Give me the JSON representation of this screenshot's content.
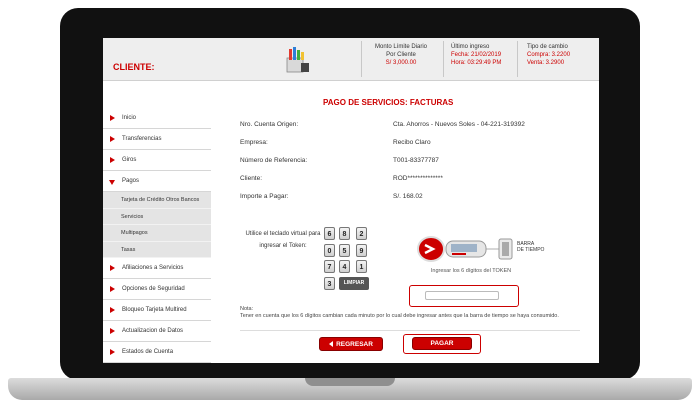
{
  "header": {
    "cliente_label": "CLIENTE:",
    "monto": {
      "line1": "Monto Límite Diario",
      "line2": "Por Cliente",
      "amount": "S/ 3,000.00"
    },
    "ingreso": {
      "title": "Último ingreso",
      "fecha": "Fecha: 21/02/2019",
      "hora": "Hora: 03:29:49 PM"
    },
    "cambio": {
      "title": "Tipo de cambio",
      "compra": "Compra: 3.2200",
      "venta": "Venta: 3.2900"
    }
  },
  "sidebar": {
    "items": [
      {
        "label": "Inicio"
      },
      {
        "label": "Transferencias"
      },
      {
        "label": "Giros"
      },
      {
        "label": "Pagos"
      },
      {
        "label": "Afiliaciones a Servicios"
      },
      {
        "label": "Opciones de Seguridad"
      },
      {
        "label": "Bloqueo Tarjeta Multired"
      },
      {
        "label": "Actualizacion de Datos"
      },
      {
        "label": "Estados de Cuenta"
      }
    ],
    "pagos_sub": [
      {
        "label": "Tarjeta de Crédito Otros Bancos"
      },
      {
        "label": "Servicios"
      },
      {
        "label": "Multipagos"
      },
      {
        "label": "Tasas"
      }
    ]
  },
  "main": {
    "title": "PAGO DE SERVICIOS: FACTURAS",
    "fields": [
      {
        "label": "Nro. Cuenta Origen:",
        "value": "Cta. Ahorros - Nuevos Soles - 04-221-319392"
      },
      {
        "label": "Empresa:",
        "value": "Recibo Claro"
      },
      {
        "label": "Número de Referencia:",
        "value": "T001-83377787"
      },
      {
        "label": "Cliente:",
        "value": "ROD**************"
      },
      {
        "label": "Importe a Pagar:",
        "value": "S/. 168.02"
      }
    ],
    "keypad_instruction": "Utilice el teclado virtual para ingresar el Token:",
    "keypad_keys": [
      "6",
      "8",
      "2",
      "0",
      "5",
      "9",
      "7",
      "4",
      "1",
      "3"
    ],
    "limpiar_label": "LIMPIAR",
    "barra_label_1": "BARRA",
    "barra_label_2": "DE TIEMPO",
    "token_caption": "Ingresar los 6 dígitos del TOKEN",
    "token_value": "",
    "note_title": "Nota:",
    "note_text": "Tener en cuenta que los 6 dígitos cambian cada minuto por lo cual debe ingresar antes que la barra de tiempo se haya consumido.",
    "regresar_label": "REGRESAR",
    "pagar_label": "PAGAR"
  },
  "colors": {
    "accent": "#cc0000",
    "header_bg": "#eeeeee",
    "submenu_bg": "#e4e4e4"
  }
}
